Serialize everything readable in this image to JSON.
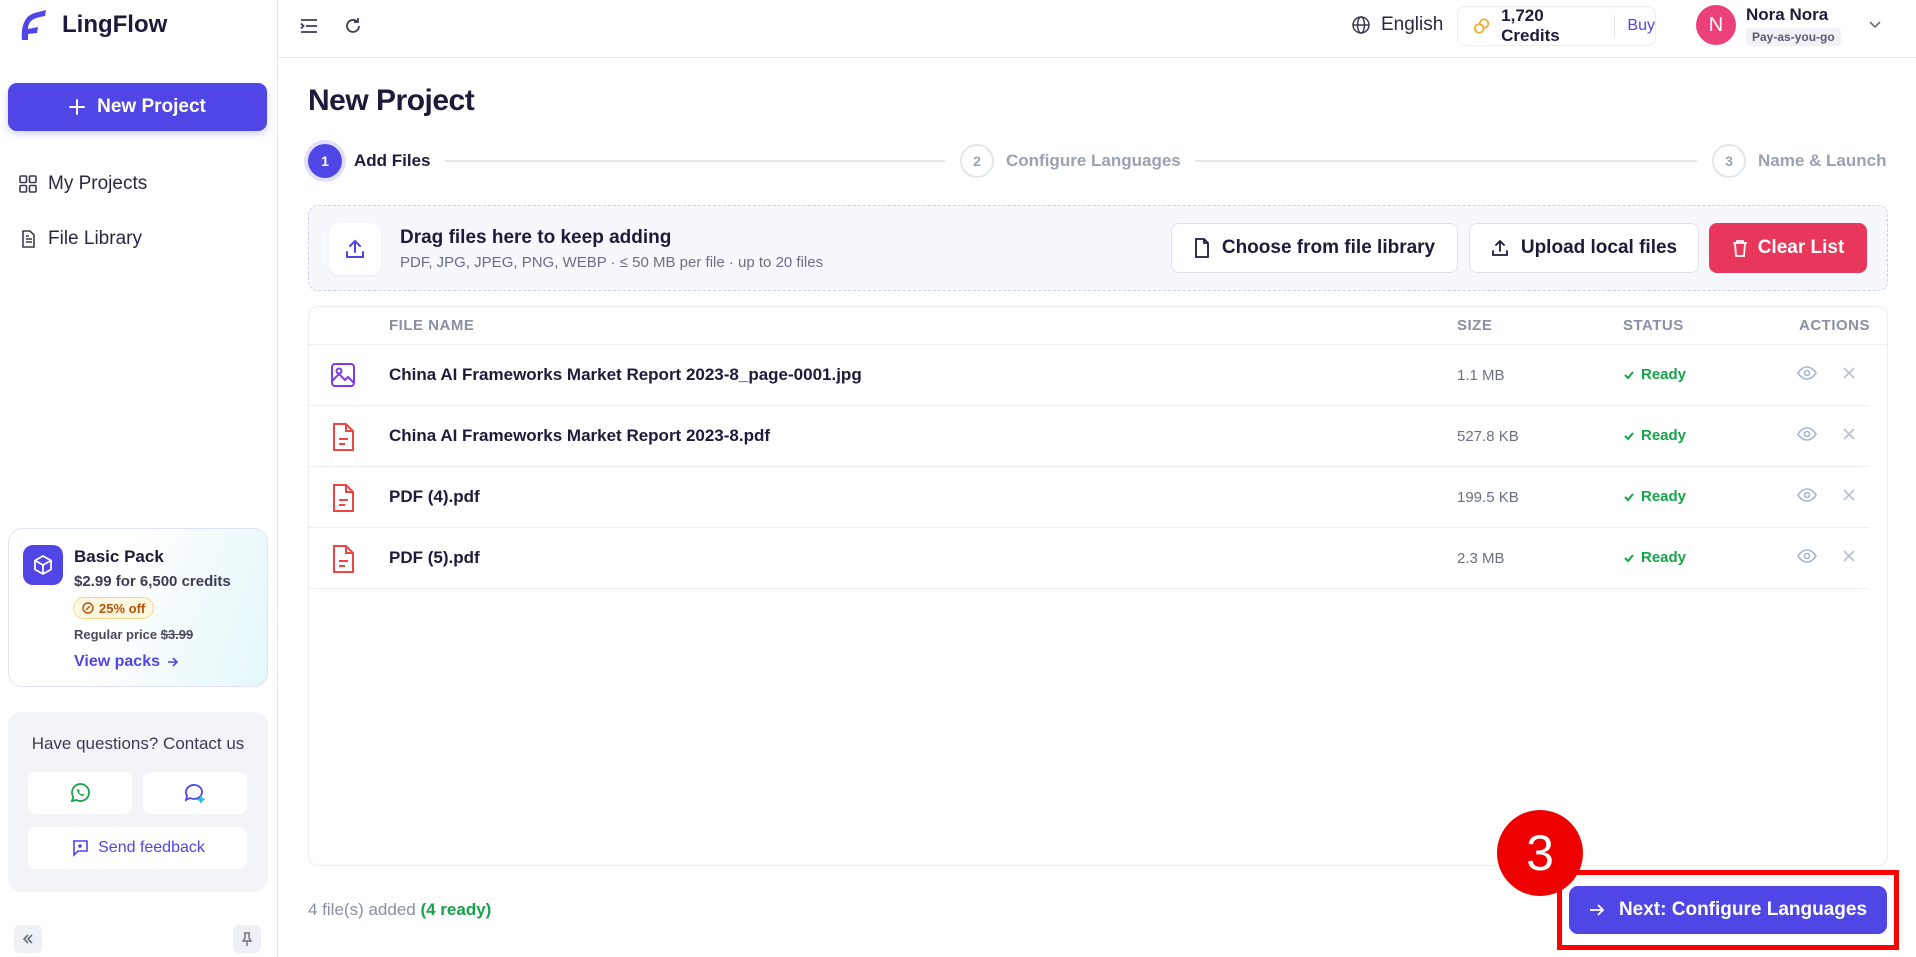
{
  "app": {
    "name": "LingFlow"
  },
  "sidebar": {
    "new_project_label": "New Project",
    "nav": [
      {
        "label": "My Projects",
        "icon": "grid-icon"
      },
      {
        "label": "File Library",
        "icon": "document-icon"
      }
    ],
    "promo": {
      "title": "Basic Pack",
      "price": "$2.99 for 6,500 credits",
      "badge": "25% off",
      "regular_label": "Regular price",
      "regular_price": "$3.99",
      "link": "View packs"
    },
    "contact": {
      "title": "Have questions? Contact us",
      "feedback_label": "Send feedback"
    }
  },
  "header": {
    "language": "English",
    "credits": "1,720 Credits",
    "buy_label": "Buy",
    "user": {
      "initial": "N",
      "name": "Nora Nora",
      "plan": "Pay-as-you-go"
    }
  },
  "page": {
    "title": "New Project",
    "steps": [
      {
        "number": "1",
        "label": "Add Files",
        "active": true
      },
      {
        "number": "2",
        "label": "Configure Languages",
        "active": false
      },
      {
        "number": "3",
        "label": "Name & Launch",
        "active": false
      }
    ],
    "dropzone": {
      "title": "Drag files here to keep adding",
      "subtitle": "PDF, JPG, JPEG, PNG, WEBP · ≤ 50 MB per file · up to 20 files",
      "choose_label": "Choose from file library",
      "upload_label": "Upload local files",
      "clear_label": "Clear List"
    },
    "table": {
      "columns": {
        "name": "FILE NAME",
        "size": "SIZE",
        "status": "STATUS",
        "actions": "ACTIONS"
      },
      "rows": [
        {
          "name": "China AI Frameworks Market Report 2023-8_page-0001.jpg",
          "size": "1.1 MB",
          "status": "Ready",
          "type": "image"
        },
        {
          "name": "China AI Frameworks Market Report 2023-8.pdf",
          "size": "527.8 KB",
          "status": "Ready",
          "type": "pdf"
        },
        {
          "name": "PDF (4).pdf",
          "size": "199.5 KB",
          "status": "Ready",
          "type": "pdf"
        },
        {
          "name": "PDF (5).pdf",
          "size": "2.3 MB",
          "status": "Ready",
          "type": "pdf"
        }
      ]
    },
    "footer": {
      "count_text": "4 file(s) added",
      "ready_text": "(4 ready)",
      "next_label": "Next: Configure Languages"
    }
  },
  "annotation": {
    "label": "3"
  },
  "colors": {
    "primary": "#4f46e5",
    "danger": "#e8375a",
    "success": "#16a34a",
    "annotation": "#ff0000"
  }
}
